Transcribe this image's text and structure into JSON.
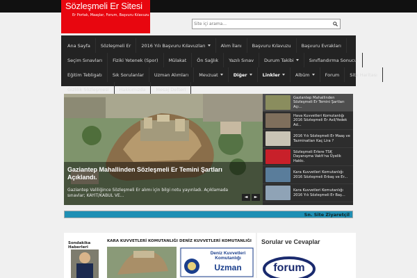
{
  "site": {
    "title": "Sözleşmeli Er Sitesi",
    "tagline": "Er Portalı, Maaşlar, Forum, Başvuru Kılavuzu"
  },
  "search": {
    "placeholder": "Site içi arama..."
  },
  "nav": {
    "rows": [
      [
        {
          "label": "Ana Sayfa"
        },
        {
          "label": "Sözleşmeli Er"
        },
        {
          "label": "2016 Yılı Başvuru Kılavuzları",
          "dropdown": true
        },
        {
          "label": "Alım İlanı"
        },
        {
          "label": "Başvuru Kılavuzu"
        },
        {
          "label": "Başvuru Evrakları"
        }
      ],
      [
        {
          "label": "Seçim Sınavları"
        },
        {
          "label": "Fiziki Yetenek (Spor)"
        },
        {
          "label": "Mülakat"
        },
        {
          "label": "Ön Sağlık"
        },
        {
          "label": "Yazılı Sınav"
        },
        {
          "label": "Durum Takibi",
          "dropdown": true
        },
        {
          "label": "Sınıflandırma Sonucu"
        }
      ],
      [
        {
          "label": "Eğitim Tebligatı"
        },
        {
          "label": "Sık Sorulanlar"
        },
        {
          "label": "Uzman Alımları"
        },
        {
          "label": "Mevzuat",
          "dropdown": true
        },
        {
          "label": "Diğer",
          "dropdown": true,
          "bold": true
        },
        {
          "label": "Linkler",
          "dropdown": true,
          "bold": true
        },
        {
          "label": "Albüm",
          "dropdown": true
        },
        {
          "label": "Forum"
        },
        {
          "label": "Site Haritası"
        }
      ],
      [
        {
          "label": "Gizlilik Sözleşmesi"
        },
        {
          "label": "Hakkımızda"
        },
        {
          "label": "Mesaj Defteri"
        }
      ]
    ]
  },
  "slider": {
    "main": {
      "title": "Gaziantep Mahallinden Sözleşmeli Er Temini Şartları Açıklandı.",
      "description": "Gaziantep Valiliğince Sözleşmeli Er alımı için bilgi notu yayınladı. Açıklamada sınavlar; KAYIT/KABUL VE..."
    },
    "prev_label": "◄",
    "next_label": "►",
    "items": [
      {
        "text": "Gaziantep Mahallinden Sözleşmeli Er Temini Şartları Açı...",
        "thumb_color": "#8a8d5e",
        "active": true
      },
      {
        "text": "Hava Kuvvetleri Komutanlığı 2016 Sözleşmeli Er Asil/Yedek Ad...",
        "thumb_color": "#7f6f5c"
      },
      {
        "text": "2016 Yılı Sözleşmeli Er Maaş ve Tazminatları Kaç Lira ?",
        "thumb_color": "#c9c4b5"
      },
      {
        "text": "Sözleşmeli Erlere TSK Dayanışma Vakfı'na Üyelik Hakkı.",
        "thumb_color": "#c8202a"
      },
      {
        "text": "Kara Kuvvetleri Komutanlığı 2016 Sözleşmeli Erbaş ve Er...",
        "thumb_color": "#5a7d9b"
      },
      {
        "text": "Kara Kuvvetleri Komutanlığı 2016 Yılı Sözleşmeli Er Baş...",
        "thumb_color": "#8fa3b6"
      }
    ]
  },
  "ticker": {
    "text": "Sn. Site Ziyaretçil"
  },
  "content": {
    "sidebar_title": "Sondakika Haberleri",
    "cards": [
      {
        "title": "KARA KUVVETLERİ KOMUTANLIĞI"
      },
      {
        "title": "DENİZ KUVVETLERİ KOMUTANLIĞI"
      }
    ],
    "card_image_text": {
      "line1": "Deniz Kuvvetleri Komutanlığı",
      "line2": "Uzman"
    }
  },
  "right": {
    "title": "Sorular ve Cevaplar",
    "image_text": "forum"
  },
  "colors": {
    "logo_bg": "#e8060f",
    "nav_bg": "#232323",
    "ticker_bg": "#1f8fb4"
  }
}
